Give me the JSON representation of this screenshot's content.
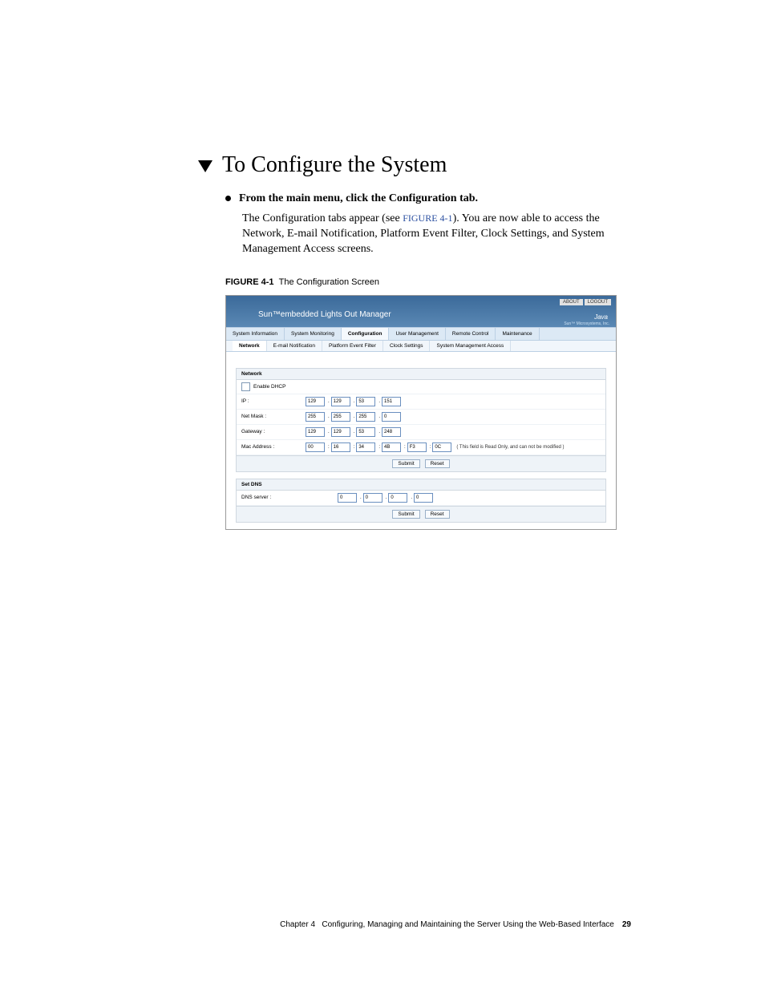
{
  "heading": "To Configure the System",
  "step_text": "From the main menu, click the Configuration tab.",
  "body_prefix": "The Configuration tabs appear (see ",
  "body_link": "FIGURE 4-1",
  "body_suffix": "). You are now able to access the Network, E-mail Notification, Platform Event Filter, Clock Settings, and System Management Access screens.",
  "figure_label": "FIGURE 4-1",
  "figure_title": "The Configuration Screen",
  "screenshot": {
    "app_title": "Sun™embedded Lights Out Manager",
    "top_buttons": {
      "about": "ABOUT",
      "logout": "LOGOUT"
    },
    "java_label": "Java",
    "corp_label": "Sun™ Microsystems, Inc.",
    "main_tabs": [
      "System Information",
      "System Monitoring",
      "Configuration",
      "User Management",
      "Remote Control",
      "Maintenance"
    ],
    "sub_tabs": [
      "Network",
      "E-mail Notification",
      "Platform Event Filter",
      "Clock Settings",
      "System Management Access"
    ],
    "network_panel": {
      "title": "Network",
      "enable_dhcp": "Enable DHCP",
      "rows": {
        "ip": {
          "label": "IP :",
          "vals": [
            "129",
            "129",
            "53",
            "151"
          ]
        },
        "netmask": {
          "label": "Net Mask :",
          "vals": [
            "255",
            "255",
            "255",
            "0"
          ]
        },
        "gateway": {
          "label": "Gateway :",
          "vals": [
            "129",
            "129",
            "53",
            "248"
          ]
        },
        "mac": {
          "label": "Mac Address :",
          "vals": [
            "00",
            "16",
            "34",
            "4B",
            "F3",
            "0C"
          ],
          "note": "( This field is Read Only, and can not be modified )"
        }
      },
      "buttons": {
        "submit": "Submit",
        "reset": "Reset"
      }
    },
    "dns_panel": {
      "title": "Set DNS",
      "row": {
        "label": "DNS server :",
        "vals": [
          "0",
          "0",
          "0",
          "0"
        ]
      },
      "buttons": {
        "submit": "Submit",
        "reset": "Reset"
      }
    }
  },
  "footer": {
    "chapter": "Chapter 4",
    "title": "Configuring, Managing and Maintaining the Server Using the Web-Based Interface",
    "page": "29"
  }
}
